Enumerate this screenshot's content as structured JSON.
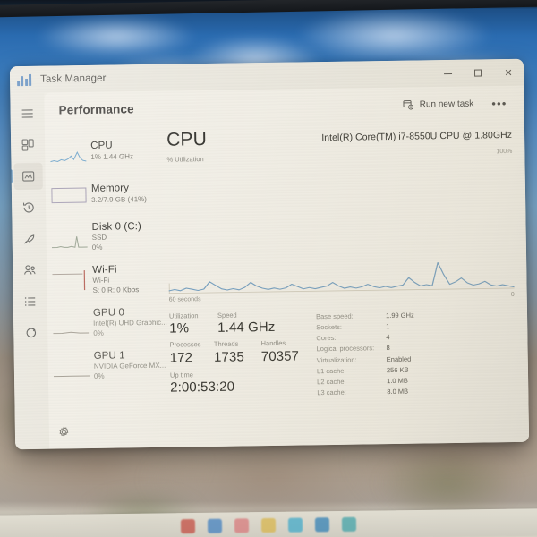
{
  "window": {
    "title": "Task Manager",
    "app_icon": "task-manager-icon",
    "controls": {
      "minimize": "–",
      "maximize": "□",
      "close": "✕"
    }
  },
  "rail": {
    "items": [
      {
        "name": "hamburger",
        "icon": "hamburger-menu-icon",
        "selected": false
      },
      {
        "name": "processes",
        "icon": "processes-icon",
        "selected": false
      },
      {
        "name": "performance",
        "icon": "performance-icon",
        "selected": true
      },
      {
        "name": "app-history",
        "icon": "history-clock-icon",
        "selected": false
      },
      {
        "name": "startup-apps",
        "icon": "rocket-icon",
        "selected": false
      },
      {
        "name": "users",
        "icon": "users-icon",
        "selected": false
      },
      {
        "name": "details",
        "icon": "details-list-icon",
        "selected": false
      },
      {
        "name": "services",
        "icon": "services-gear-icon",
        "selected": false
      }
    ],
    "settings_icon": "settings-gear-icon"
  },
  "header": {
    "page_title": "Performance",
    "run_new_task_label": "Run new task",
    "run_new_task_icon": "run-new-task-icon",
    "more_label": "•••"
  },
  "resources": [
    {
      "name": "CPU",
      "line1": "1%  1.44 GHz",
      "line2": "",
      "accent": "#4a8fc4",
      "selected": true
    },
    {
      "name": "Memory",
      "line1": "3.2/7.9 GB (41%)",
      "line2": "",
      "accent": "#8a7fa8",
      "selected": false
    },
    {
      "name": "Disk 0 (C:)",
      "line1": "SSD",
      "line2": "0%",
      "accent": "#5aa06a",
      "selected": false
    },
    {
      "name": "Wi-Fi",
      "line1": "Wi-Fi",
      "line2": "S: 0 R: 0 Kbps",
      "accent": "#b2564a",
      "selected": false
    },
    {
      "name": "GPU 0",
      "line1": "Intel(R) UHD Graphic...",
      "line2": "0%",
      "accent": "#7a8fa0",
      "selected": false
    },
    {
      "name": "GPU 1",
      "line1": "NVIDIA GeForce MX...",
      "line2": "0%",
      "accent": "#7a8fa0",
      "selected": false
    }
  ],
  "detail": {
    "title": "CPU",
    "axis_label": "% Utilization",
    "model": "Intel(R) Core(TM) i7-8550U CPU @ 1.80GHz",
    "scale_max": "100%",
    "graph_left_label": "60 seconds",
    "graph_right_label": "0"
  },
  "stats": {
    "utilization": {
      "label": "Utilization",
      "value": "1%"
    },
    "speed": {
      "label": "Speed",
      "value": "1.44 GHz"
    },
    "processes": {
      "label": "Processes",
      "value": "172"
    },
    "threads": {
      "label": "Threads",
      "value": "1735"
    },
    "handles": {
      "label": "Handles",
      "value": "70357"
    },
    "uptime": {
      "label": "Up time",
      "value": "2:00:53:20"
    }
  },
  "specs": [
    {
      "label": "Base speed:",
      "value": "1.99 GHz"
    },
    {
      "label": "Sockets:",
      "value": "1"
    },
    {
      "label": "Cores:",
      "value": "4"
    },
    {
      "label": "Logical processors:",
      "value": "8"
    },
    {
      "label": "Virtualization:",
      "value": "Enabled"
    },
    {
      "label": "L1 cache:",
      "value": "256 KB"
    },
    {
      "label": "L2 cache:",
      "value": "1.0 MB"
    },
    {
      "label": "L3 cache:",
      "value": "8.0 MB"
    }
  ],
  "chart_data": {
    "type": "line",
    "title": "CPU % Utilization",
    "xlabel": "60 seconds",
    "ylabel": "% Utilization",
    "ylim": [
      0,
      100
    ],
    "x_axis_reversed": true,
    "grid": false,
    "series": [
      {
        "name": "CPU utilization",
        "color": "#6f9bbd",
        "values": [
          2,
          3,
          2,
          4,
          3,
          2,
          3,
          9,
          6,
          3,
          2,
          3,
          2,
          4,
          8,
          5,
          3,
          2,
          3,
          2,
          3,
          6,
          4,
          2,
          3,
          2,
          3,
          4,
          7,
          4,
          2,
          3,
          2,
          3,
          5,
          3,
          2,
          3,
          2,
          3,
          4,
          10,
          6,
          3,
          4,
          3,
          22,
          12,
          4,
          6,
          9,
          5,
          3,
          4,
          6,
          3,
          2,
          3,
          2,
          1
        ]
      }
    ]
  },
  "taskbar": {
    "icons": [
      "app-icon-1",
      "app-icon-2",
      "app-icon-3",
      "app-icon-4",
      "app-icon-5",
      "app-icon-6",
      "app-icon-7"
    ]
  }
}
